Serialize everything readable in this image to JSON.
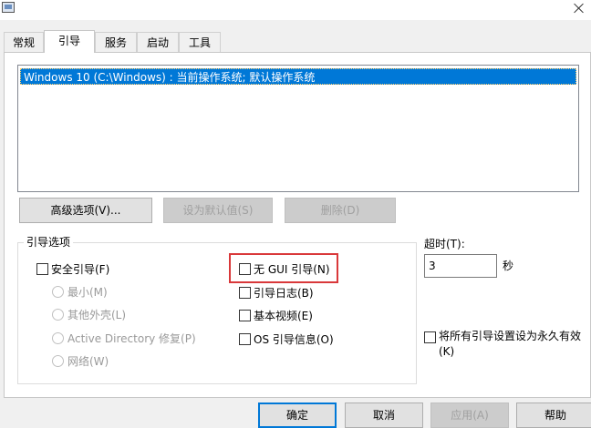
{
  "tabs": [
    "常规",
    "引导",
    "服务",
    "启动",
    "工具"
  ],
  "active_tab": "引导",
  "os_list": [
    "Windows 10 (C:\\Windows) : 当前操作系统; 默认操作系统"
  ],
  "buttons": {
    "advanced": "高级选项(V)...",
    "set_default": "设为默认值(S)",
    "delete": "删除(D)"
  },
  "boot_options": {
    "group_title": "引导选项",
    "safe_boot": "安全引导(F)",
    "minimal": "最小(M)",
    "alternate_shell": "其他外壳(L)",
    "active_directory": "Active Directory 修复(P)",
    "network": "网络(W)",
    "no_gui_boot": "无 GUI 引导(N)",
    "boot_log": "引导日志(B)",
    "base_video": "基本视频(E)",
    "os_boot_info": "OS 引导信息(O)"
  },
  "timeout": {
    "label": "超时(T):",
    "value": "3",
    "unit": "秒"
  },
  "persist_label": "将所有引导设置设为永久有效(K)",
  "footer": {
    "ok": "确定",
    "cancel": "取消",
    "apply": "应用(A)",
    "help": "帮助"
  },
  "colors": {
    "selection": "#0078d7",
    "highlight_box": "#d9383a"
  }
}
